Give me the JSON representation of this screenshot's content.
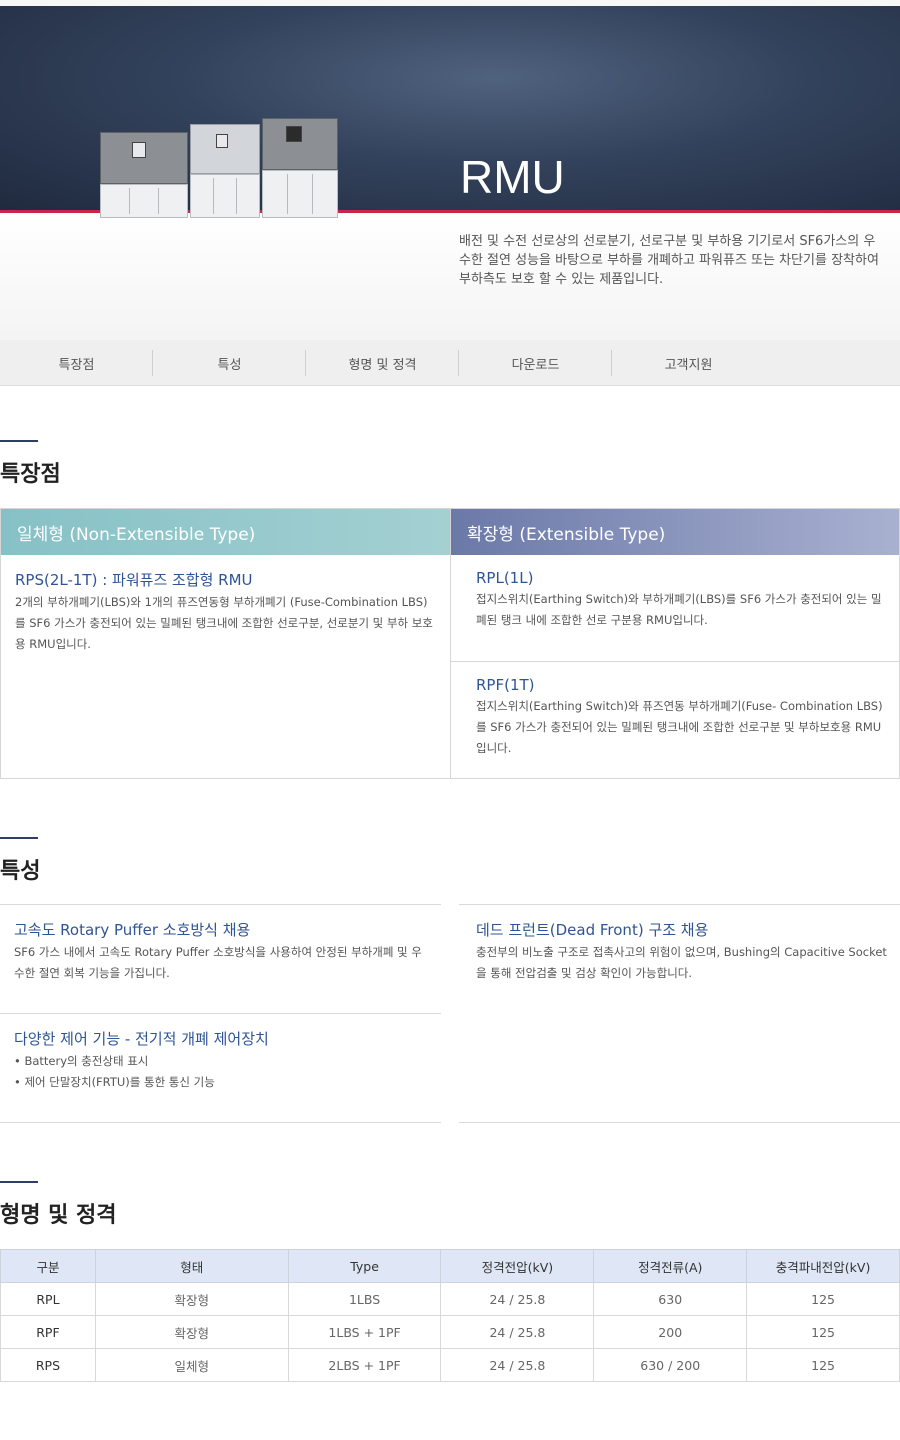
{
  "hero": {
    "title": "RMU",
    "description": "배전 및 수전 선로상의 선로분기, 선로구분 및 부하용 기기로서 SF6가스의 우수한 절연 성능을 바탕으로 부하를 개폐하고 파워퓨즈 또는 차단기를 장착하여 부하측도 보호 할 수 있는 제품입니다."
  },
  "nav": [
    "특장점",
    "특성",
    "형명 및 정격",
    "다운로드",
    "고객지원"
  ],
  "features": {
    "title": "특장점",
    "left": {
      "header": "일체형 (Non-Extensible Type)",
      "items": [
        {
          "title": "RPS(2L-1T) : 파워퓨즈 조합형 RMU",
          "text": "2개의 부하개폐기(LBS)와 1개의 퓨즈연동형 부하개폐기 (Fuse-Combination LBS)를 SF6 가스가 충전되어 있는 밀폐된 탱크내에 조합한 선로구분, 선로분기 및 부하 보호용 RMU입니다."
        }
      ]
    },
    "right": {
      "header": "확장형 (Extensible Type)",
      "items": [
        {
          "title": "RPL(1L)",
          "text": "접지스위치(Earthing Switch)와 부하개폐기(LBS)를 SF6 가스가 충전되어 있는 밀폐된 탱크 내에 조합한 선로 구분용 RMU입니다."
        },
        {
          "title": "RPF(1T)",
          "text": "접지스위치(Earthing Switch)와 퓨즈연동 부하개폐기(Fuse- Combination LBS)를 SF6 가스가 충전되어 있는 밀폐된 탱크내에 조합한 선로구분 및 부하보호용 RMU입니다."
        }
      ]
    }
  },
  "characteristics": {
    "title": "특성",
    "items": [
      {
        "title": "고속도 Rotary Puffer 소호방식 채용",
        "text": "SF6 가스 내에서 고속도 Rotary Puffer 소호방식을 사용하여 안정된 부하개폐 및 우수한 절연 회복 기능을 가집니다."
      },
      {
        "title": "데드 프런트(Dead Front) 구조 채용",
        "text": "충전부의 비노출 구조로 접촉사고의 위험이 없으며, Bushing의 Capacitive Socket을 통해 전압검출 및 검상 확인이 가능합니다."
      },
      {
        "title": "다양한 제어 기능 - 전기적 개폐 제어장치",
        "bullets": [
          "• Battery의 충전상태 표시",
          "• 제어 단말장치(FRTU)를 통한 통신 기능"
        ]
      }
    ]
  },
  "ratings": {
    "title": "형명 및 정격",
    "headers": [
      "구분",
      "형태",
      "Type",
      "정격전압(kV)",
      "정격전류(A)",
      "충격파내전압(kV)"
    ],
    "rows": [
      [
        "RPL",
        "확장형",
        "1LBS",
        "24 / 25.8",
        "630",
        "125"
      ],
      [
        "RPF",
        "확장형",
        "1LBS + 1PF",
        "24 / 25.8",
        "200",
        "125"
      ],
      [
        "RPS",
        "일체형",
        "2LBS + 1PF",
        "24 / 25.8",
        "630 / 200",
        "125"
      ]
    ]
  }
}
